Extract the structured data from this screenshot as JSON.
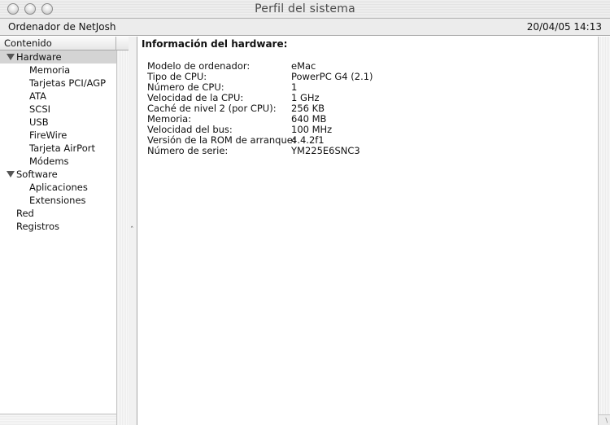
{
  "window": {
    "title": "Perfil del sistema"
  },
  "infobar": {
    "computer_name": "Ordenador de NetJosh",
    "datetime": "20/04/05 14:13"
  },
  "sidebar": {
    "header": "Contenido",
    "tree": [
      {
        "label": "Hardware",
        "level": 0,
        "expanded": true,
        "selected": true
      },
      {
        "label": "Memoria",
        "level": 1
      },
      {
        "label": "Tarjetas PCI/AGP",
        "level": 1
      },
      {
        "label": "ATA",
        "level": 1
      },
      {
        "label": "SCSI",
        "level": 1
      },
      {
        "label": "USB",
        "level": 1
      },
      {
        "label": "FireWire",
        "level": 1
      },
      {
        "label": "Tarjeta AirPort",
        "level": 1
      },
      {
        "label": "Módems",
        "level": 1
      },
      {
        "label": "Software",
        "level": 0,
        "expanded": true
      },
      {
        "label": "Aplicaciones",
        "level": 1
      },
      {
        "label": "Extensiones",
        "level": 1
      },
      {
        "label": "Red",
        "level": 0
      },
      {
        "label": "Registros",
        "level": 0
      }
    ]
  },
  "content": {
    "section_title": "Información del hardware:",
    "specs": [
      {
        "label": "Modelo de ordenador:",
        "value": "eMac"
      },
      {
        "label": "Tipo de CPU:",
        "value": "PowerPC G4  (2.1)"
      },
      {
        "label": "Número de CPU:",
        "value": "1"
      },
      {
        "label": "Velocidad de la CPU:",
        "value": "1 GHz"
      },
      {
        "label": "Caché de nivel 2 (por CPU):",
        "value": "256 KB"
      },
      {
        "label": "Memoria:",
        "value": "640 MB"
      },
      {
        "label": "Velocidad del bus:",
        "value": "100 MHz"
      },
      {
        "label": "Versión de la ROM de arranque:",
        "value": "4.4.2f1"
      },
      {
        "label": "Número de serie:",
        "value": "YM225E6SNC3"
      }
    ]
  },
  "icons": {
    "close": "close-button-icon",
    "minimize": "minimize-button-icon",
    "zoom": "zoom-button-icon",
    "disclosure": "disclosure-triangle-icon",
    "splitter": "collapse-arrow-icon",
    "resize": "resize-grip-icon"
  },
  "colors": {
    "selection": "#d4d4d4",
    "titlebar": "#e8e8e8"
  }
}
